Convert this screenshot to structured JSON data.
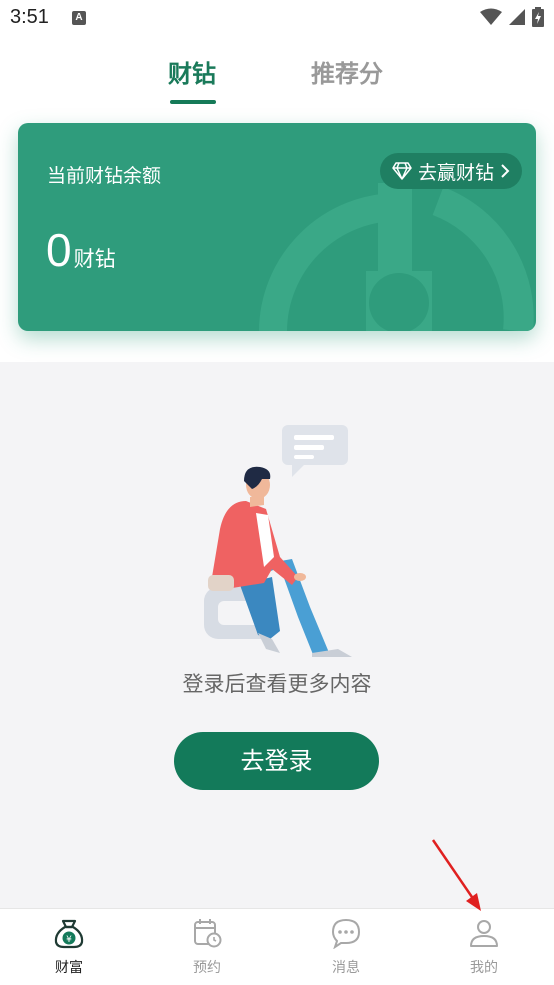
{
  "status_bar": {
    "time": "3:51",
    "notification_glyph": "A"
  },
  "tabs": [
    {
      "label": "财钻",
      "active": true
    },
    {
      "label": "推荐分",
      "active": false
    }
  ],
  "card": {
    "title": "当前财钻余额",
    "balance_value": "0",
    "balance_unit": "财钻",
    "earn_button": "去赢财钻",
    "color": "#2f9c7c"
  },
  "empty_state": {
    "message": "登录后查看更多内容",
    "login_button": "去登录"
  },
  "bottom_nav": [
    {
      "label": "财富",
      "icon": "money-bag-icon",
      "active": true
    },
    {
      "label": "预约",
      "icon": "calendar-clock-icon",
      "active": false
    },
    {
      "label": "消息",
      "icon": "chat-bubble-icon",
      "active": false
    },
    {
      "label": "我的",
      "icon": "user-icon",
      "active": false
    }
  ],
  "colors": {
    "accent": "#137a5a",
    "annotation_arrow": "#e02020"
  }
}
